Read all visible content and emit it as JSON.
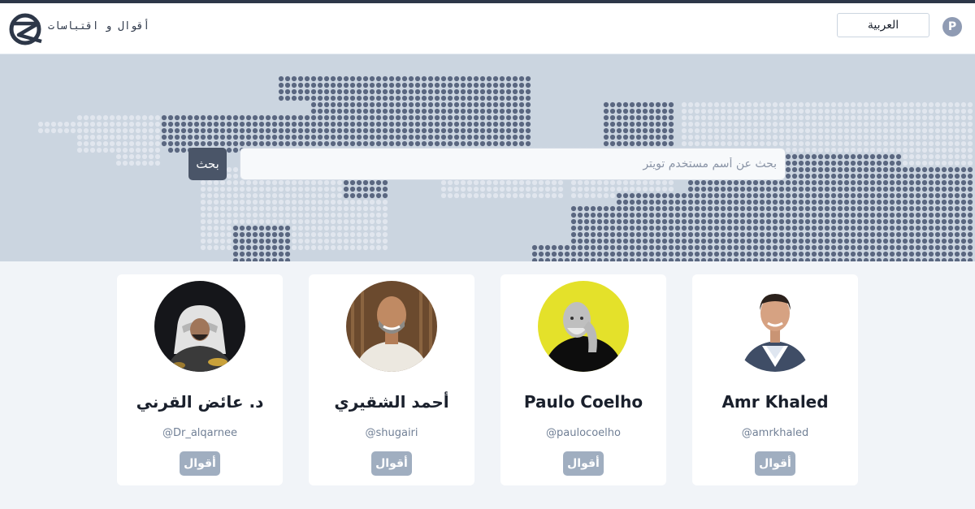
{
  "header": {
    "brand_text": "أقوال و اقتباسات",
    "language_selector": "العربية",
    "pinterest_icon": "pinterest-icon"
  },
  "search": {
    "placeholder": "بحث عن أسم مستخدم تويتر",
    "button_label": "بحث"
  },
  "cards": [
    {
      "name": "Amr Khaled",
      "handle": "@amrkhaled",
      "button_label": "أقوال"
    },
    {
      "name": "Paulo Coelho",
      "handle": "@paulocoelho",
      "button_label": "أقوال"
    },
    {
      "name": "أحمد الشقيري",
      "handle": "@shugairi",
      "button_label": "أقوال"
    },
    {
      "name": "د. عائض القرني",
      "handle": "@Dr_alqarnee",
      "button_label": "أقوال"
    }
  ],
  "colors": {
    "header_bar": "#2d3748",
    "hero_background": "#cbd5e0",
    "search_button": "#4a5568",
    "card_button": "#a0aec0"
  }
}
